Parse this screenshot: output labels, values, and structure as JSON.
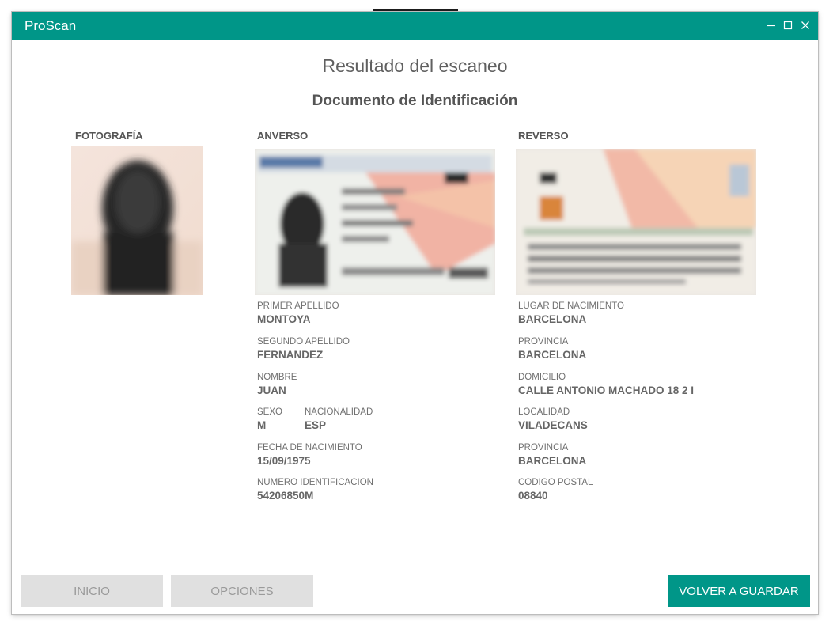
{
  "window": {
    "app_title": "ProScan",
    "minimize_icon": "minimize-icon",
    "maximize_icon": "maximize-icon",
    "close_icon": "close-icon"
  },
  "page": {
    "title": "Resultado del escaneo",
    "section_title": "Documento de Identificación"
  },
  "columns": {
    "photo_title": "FOTOGRAFÍA",
    "front_title": "ANVERSO",
    "back_title": "REVERSO"
  },
  "front_fields": {
    "primer_apellido": {
      "label": "PRIMER APELLIDO",
      "value": "MONTOYA"
    },
    "segundo_apellido": {
      "label": "SEGUNDO APELLIDO",
      "value": "FERNANDEZ"
    },
    "nombre": {
      "label": "NOMBRE",
      "value": "JUAN"
    },
    "sexo": {
      "label": "SEXO",
      "value": "M"
    },
    "nacionalidad": {
      "label": "NACIONALIDAD",
      "value": "ESP"
    },
    "fecha_nacimiento": {
      "label": "FECHA DE NACIMIENTO",
      "value": "15/09/1975"
    },
    "numero_identificacion": {
      "label": "NUMERO IDENTIFICACION",
      "value": "54206850M"
    }
  },
  "back_fields": {
    "lugar_nacimiento": {
      "label": "LUGAR DE NACIMIENTO",
      "value": "BARCELONA"
    },
    "provincia_nacimiento": {
      "label": "PROVINCIA",
      "value": "BARCELONA"
    },
    "domicilio": {
      "label": "DOMICILIO",
      "value": "CALLE ANTONIO MACHADO 18 2 I"
    },
    "localidad": {
      "label": "LOCALIDAD",
      "value": "VILADECANS"
    },
    "provincia_domicilio": {
      "label": "PROVINCIA",
      "value": "BARCELONA"
    },
    "codigo_postal": {
      "label": "CODIGO POSTAL",
      "value": "08840"
    }
  },
  "buttons": {
    "inicio": "INICIO",
    "opciones": "OPCIONES",
    "volver": "VOLVER A GUARDAR"
  },
  "colors": {
    "accent": "#009688",
    "button_disabled": "#e0e0e0"
  }
}
